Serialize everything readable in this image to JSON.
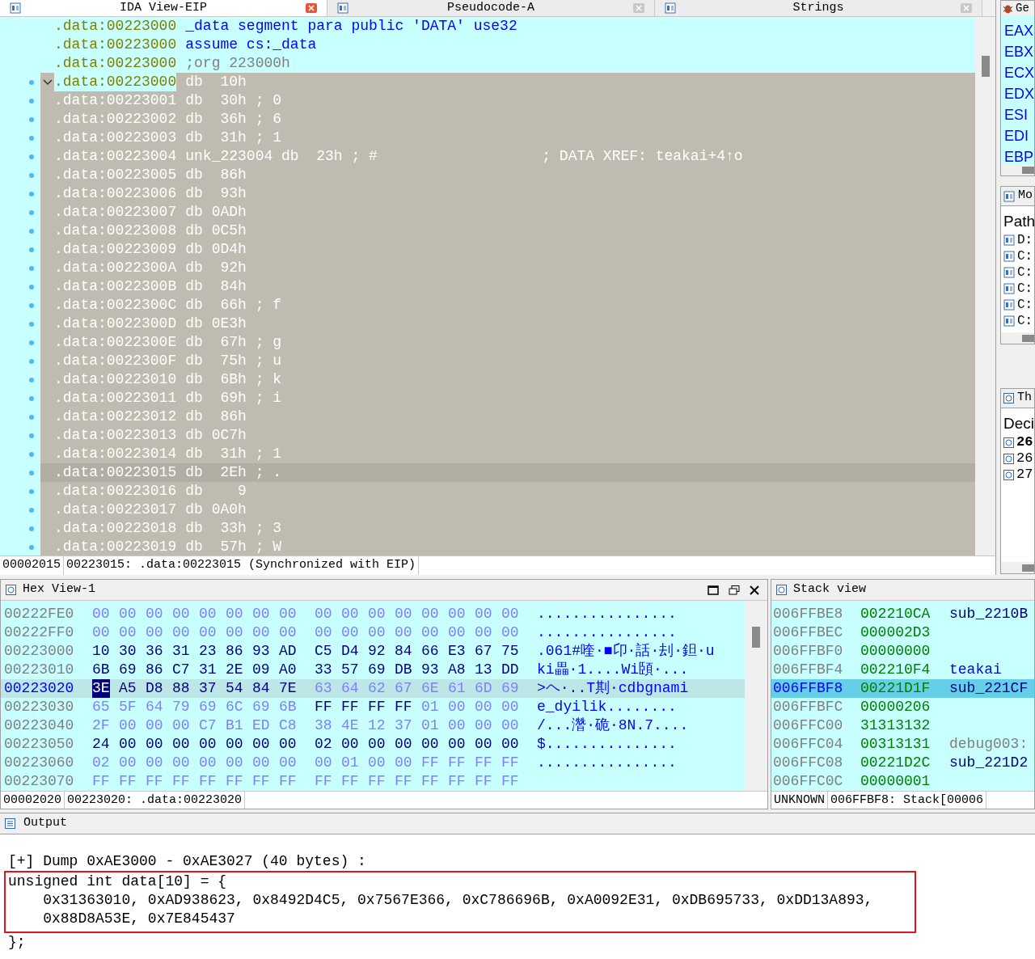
{
  "tabs": [
    {
      "label": "IDA View-EIP",
      "selected": true
    },
    {
      "label": "Pseudocode-A",
      "selected": false
    },
    {
      "label": "Strings",
      "selected": false
    }
  ],
  "listing": {
    "lines": [
      {
        "address": ".data:00223000",
        "text": "_data segment para public 'DATA' use32",
        "kind": "directive",
        "selected": false,
        "current": false
      },
      {
        "address": ".data:00223000",
        "text": "assume cs:_data",
        "kind": "directive",
        "selected": false,
        "current": false
      },
      {
        "address": ".data:00223000",
        "text": ";org 223000h",
        "kind": "comment",
        "selected": false,
        "current": false
      },
      {
        "address": ".data:00223000",
        "text": "db  10h",
        "kind": "data",
        "selected": true,
        "current": false,
        "expanded": true
      },
      {
        "address": ".data:00223001",
        "text": "db  30h ; 0",
        "kind": "data",
        "selected": true,
        "current": false
      },
      {
        "address": ".data:00223002",
        "text": "db  36h ; 6",
        "kind": "data",
        "selected": true,
        "current": false
      },
      {
        "address": ".data:00223003",
        "text": "db  31h ; 1",
        "kind": "data",
        "selected": true,
        "current": false
      },
      {
        "address": ".data:00223004",
        "text": "unk_223004 db  23h ; #",
        "xref": "; DATA XREF: teakai+4↑o",
        "kind": "data",
        "selected": true,
        "current": false
      },
      {
        "address": ".data:00223005",
        "text": "db  86h",
        "kind": "data",
        "selected": true,
        "current": false
      },
      {
        "address": ".data:00223006",
        "text": "db  93h",
        "kind": "data",
        "selected": true,
        "current": false
      },
      {
        "address": ".data:00223007",
        "text": "db 0ADh",
        "kind": "data",
        "selected": true,
        "current": false
      },
      {
        "address": ".data:00223008",
        "text": "db 0C5h",
        "kind": "data",
        "selected": true,
        "current": false
      },
      {
        "address": ".data:00223009",
        "text": "db 0D4h",
        "kind": "data",
        "selected": true,
        "current": false
      },
      {
        "address": ".data:0022300A",
        "text": "db  92h",
        "kind": "data",
        "selected": true,
        "current": false
      },
      {
        "address": ".data:0022300B",
        "text": "db  84h",
        "kind": "data",
        "selected": true,
        "current": false
      },
      {
        "address": ".data:0022300C",
        "text": "db  66h ; f",
        "kind": "data",
        "selected": true,
        "current": false
      },
      {
        "address": ".data:0022300D",
        "text": "db 0E3h",
        "kind": "data",
        "selected": true,
        "current": false
      },
      {
        "address": ".data:0022300E",
        "text": "db  67h ; g",
        "kind": "data",
        "selected": true,
        "current": false
      },
      {
        "address": ".data:0022300F",
        "text": "db  75h ; u",
        "kind": "data",
        "selected": true,
        "current": false
      },
      {
        "address": ".data:00223010",
        "text": "db  6Bh ; k",
        "kind": "data",
        "selected": true,
        "current": false
      },
      {
        "address": ".data:00223011",
        "text": "db  69h ; i",
        "kind": "data",
        "selected": true,
        "current": false
      },
      {
        "address": ".data:00223012",
        "text": "db  86h",
        "kind": "data",
        "selected": true,
        "current": false
      },
      {
        "address": ".data:00223013",
        "text": "db 0C7h",
        "kind": "data",
        "selected": true,
        "current": false
      },
      {
        "address": ".data:00223014",
        "text": "db  31h ; 1",
        "kind": "data",
        "selected": true,
        "current": false
      },
      {
        "address": ".data:00223015",
        "text": "db  2Eh ; .",
        "kind": "data",
        "selected": true,
        "current": true
      },
      {
        "address": ".data:00223016",
        "text": "db    9",
        "kind": "data",
        "selected": true,
        "current": false
      },
      {
        "address": ".data:00223017",
        "text": "db 0A0h",
        "kind": "data",
        "selected": true,
        "current": false
      },
      {
        "address": ".data:00223018",
        "text": "db  33h ; 3",
        "kind": "data",
        "selected": true,
        "current": false
      },
      {
        "address": ".data:00223019",
        "text": "db  57h ; W",
        "kind": "data",
        "selected": true,
        "current": false
      }
    ],
    "status": [
      "00002015",
      "00223015: .data:00223015 (Synchronized with EIP)"
    ]
  },
  "registers": {
    "title": "Ge",
    "names": [
      "EAX",
      "EBX",
      "ECX",
      "EDX",
      "ESI",
      "EDI",
      "EBP"
    ]
  },
  "modules": {
    "title": "Mo",
    "header": "Path",
    "rows": [
      "D:",
      "C:",
      "C:",
      "C:",
      "C:",
      "C:"
    ]
  },
  "threads": {
    "title": "Th",
    "header": "Deci",
    "rows": [
      {
        "text": "26",
        "current": true
      },
      {
        "text": "26",
        "current": false
      },
      {
        "text": "27",
        "current": false
      }
    ]
  },
  "hex_view": {
    "title": "Hex View-1",
    "rows": [
      {
        "address": "00222FE0",
        "selected": false,
        "runs": [
          {
            "hex": "00 00 00 00 00 00 00 00 00 00 00 00 00 00 00 00",
            "defined": false,
            "selected": false
          }
        ],
        "ascii": "................"
      },
      {
        "address": "00222FF0",
        "selected": false,
        "runs": [
          {
            "hex": "00 00 00 00 00 00 00 00 00 00 00 00 00 00 00 00",
            "defined": false,
            "selected": false
          }
        ],
        "ascii": "................"
      },
      {
        "address": "00223000",
        "selected": false,
        "runs": [
          {
            "hex": "10 30 36 31 23 86 93 AD C5 D4 92 84 66 E3 67 75",
            "defined": true,
            "selected": false
          }
        ],
        "ascii": ".061#喹·■卬·話·刦·鉭·u"
      },
      {
        "address": "00223010",
        "selected": false,
        "runs": [
          {
            "hex": "6B 69 86 C7 31 2E 09 A0 33 57 69 DB 93 A8 13 DD",
            "defined": true,
            "selected": false
          }
        ],
        "ascii": "ki畾·1....Wi頣·..."
      },
      {
        "address": "00223020",
        "selected": true,
        "runs": [
          {
            "hex": "3E",
            "defined": true,
            "selected": true
          },
          {
            "hex": "A5 D8 88 37 54 84 7E",
            "defined": true,
            "selected": false
          },
          {
            "hex": "63 64 62 67 6E 61 6D 69",
            "defined": false,
            "selected": false
          }
        ],
        "ascii": ">ヘ·..T剘·cdbgnami"
      },
      {
        "address": "00223030",
        "selected": false,
        "runs": [
          {
            "hex": "65 5F 64 79 69 6C 69 6B",
            "defined": false,
            "selected": false
          },
          {
            "hex": "FF FF FF FF",
            "defined": true,
            "selected": false
          },
          {
            "hex": "01 00 00 00",
            "defined": false,
            "selected": false
          }
        ],
        "ascii": "e_dyilik........"
      },
      {
        "address": "00223040",
        "selected": false,
        "runs": [
          {
            "hex": "2F 00 00 00 C7 B1 ED C8 38 4E 12 37 01 00 00 00",
            "defined": false,
            "selected": false
          }
        ],
        "ascii": "/...濳·硊·8N.7...."
      },
      {
        "address": "00223050",
        "selected": false,
        "runs": [
          {
            "hex": "24 00 00 00 00 00 00 00 02 00 00 00 00 00 00 00",
            "defined": true,
            "selected": false
          }
        ],
        "ascii": "$..............."
      },
      {
        "address": "00223060",
        "selected": false,
        "runs": [
          {
            "hex": "02 00 00 00 00 00 00 00 00 01 00 00 FF FF FF FF",
            "defined": false,
            "selected": false
          }
        ],
        "ascii": "................"
      },
      {
        "address": "00223070",
        "selected": false,
        "runs": [
          {
            "hex": "FF FF FF FF FF FF FF FF FF FF FF FF FF FF FF FF",
            "defined": false,
            "selected": false
          }
        ],
        "ascii": ""
      }
    ],
    "status": [
      "00002020",
      "00223020: .data:00223020"
    ]
  },
  "stack_view": {
    "title": "Stack view",
    "rows": [
      {
        "address": "006FFBE8",
        "value": "002210CA",
        "label": "sub_2210B",
        "kind": "code",
        "selected": false
      },
      {
        "address": "006FFBEC",
        "value": "000002D3",
        "selected": false
      },
      {
        "address": "006FFBF0",
        "value": "00000000",
        "selected": false
      },
      {
        "address": "006FFBF4",
        "value": "002210F4",
        "label": "teakai",
        "kind": "func",
        "selected": false
      },
      {
        "address": "006FFBF8",
        "value": "00221D1F",
        "label": "sub_221CF",
        "kind": "code",
        "selected": true
      },
      {
        "address": "006FFBFC",
        "value": "00000206",
        "selected": false
      },
      {
        "address": "006FFC00",
        "value": "31313132",
        "selected": false
      },
      {
        "address": "006FFC04",
        "value": "00313131",
        "label": "debug003:",
        "kind": "debug",
        "selected": false
      },
      {
        "address": "006FFC08",
        "value": "00221D2C",
        "label": "sub_221D2",
        "kind": "code",
        "selected": false
      },
      {
        "address": "006FFC0C",
        "value": "00000001",
        "selected": false
      }
    ],
    "status": [
      "UNKNOWN",
      "006FFBF8: Stack[00006"
    ]
  },
  "output": {
    "title": "Output",
    "lines": [
      "[+] Dump 0xAE3000 - 0xAE3027 (40 bytes) :"
    ],
    "highlighted_lines": [
      "unsigned int data[10] = {",
      "    0x31363010, 0xAD938623, 0x8492D4C5, 0x7567E366, 0xC786696B, 0xA0092E31, 0xDB695733, 0xDD13A893,",
      "    0x88D8A53E, 0x7E845437"
    ],
    "trailing_lines": [
      "};"
    ]
  }
}
